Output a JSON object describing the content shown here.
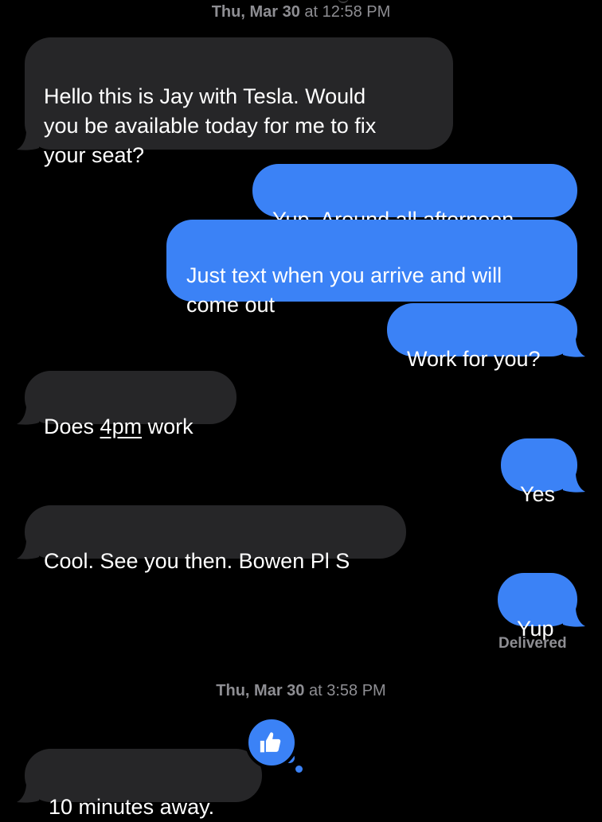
{
  "timestamps": [
    {
      "day": "Thu, Mar 30",
      "time": " at 12:58 PM"
    },
    {
      "day": "Thu, Mar 30",
      "time": " at 3:58 PM"
    }
  ],
  "messages": [
    {
      "from": "them",
      "text": "Hello this is Jay with Tesla. Would\nyou be available today for me to fix\nyour seat?"
    },
    {
      "from": "me",
      "text": "Yup. Around all afternoon"
    },
    {
      "from": "me",
      "text": "Just text when you arrive and will\ncome out"
    },
    {
      "from": "me",
      "text": "Work for you?"
    },
    {
      "from": "them",
      "text_before": "Does ",
      "link": "4pm",
      "text_after": " work"
    },
    {
      "from": "me",
      "text": "Yes"
    },
    {
      "from": "them",
      "text": "Cool. See you then. Bowen Pl S"
    },
    {
      "from": "me",
      "text": "Yup"
    },
    {
      "from": "them",
      "text": "10 minutes away."
    }
  ],
  "receipt": "Delivered",
  "tapback": {
    "icon": "thumbs-up-icon",
    "color": "#3b82f6"
  },
  "colors": {
    "incoming_bubble": "#262628",
    "outgoing_bubble": "#3b82f6",
    "background": "#000000",
    "meta_text": "#8e8e93"
  }
}
